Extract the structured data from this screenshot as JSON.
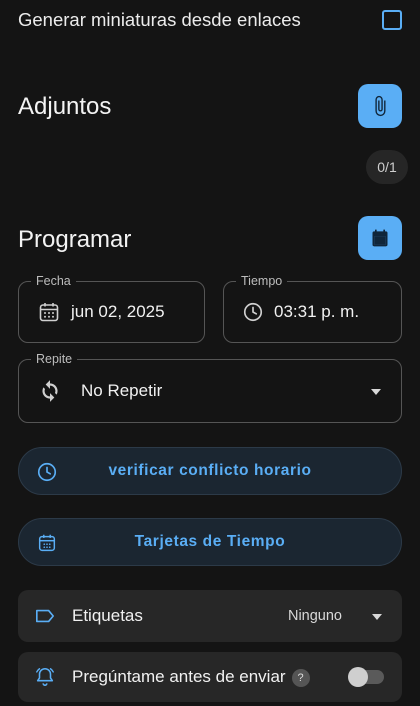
{
  "thumbnails": {
    "label": "Generar miniaturas desde enlaces",
    "checked": false
  },
  "attachments": {
    "title": "Adjuntos",
    "counter": "0/1"
  },
  "schedule": {
    "title": "Programar",
    "date": {
      "legend": "Fecha",
      "value": "jun 02, 2025"
    },
    "time": {
      "legend": "Tiempo",
      "value": "03:31 p. m."
    },
    "repeat": {
      "legend": "Repite",
      "value": "No Repetir"
    }
  },
  "buttons": {
    "check_conflict": "verificar conflicto horario",
    "time_cards": "Tarjetas de Tiempo"
  },
  "tags": {
    "label": "Etiquetas",
    "value": "Ninguno"
  },
  "ask_before_send": {
    "label": "Pregúntame antes de enviar",
    "help": "?",
    "enabled": false
  },
  "colors": {
    "accent": "#5aaef5",
    "background": "#141414",
    "card": "#272727"
  }
}
